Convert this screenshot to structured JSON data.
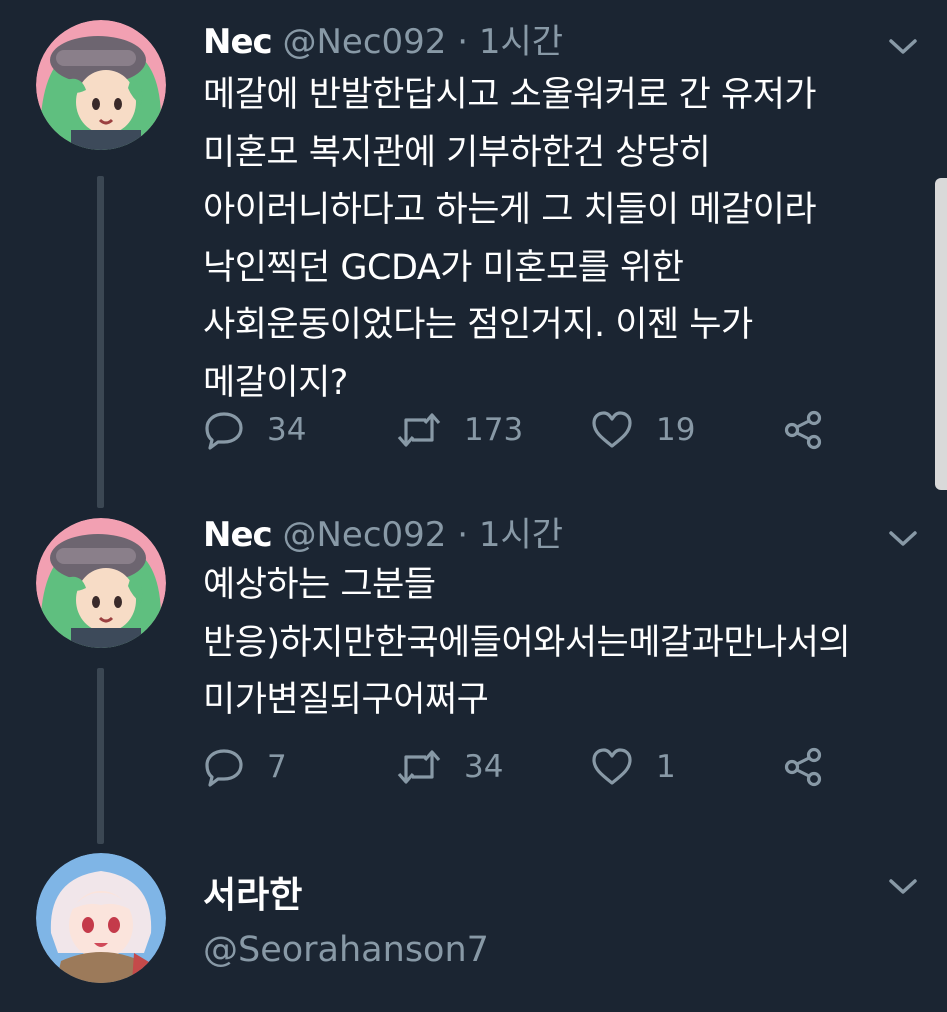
{
  "colors": {
    "background": "#1b2532",
    "text_primary": "#ffffff",
    "text_secondary": "#8899a6",
    "thread_line": "#3b4753"
  },
  "tweets": [
    {
      "name": "Nec",
      "handle": "@Nec092",
      "separator": "·",
      "time": "1시간",
      "avatar": "green-hair-character-avatar",
      "lines": [
        "메갈에 반발한답시고 소울워커로 간 유저가",
        "미혼모 복지관에 기부하한건 상당히",
        "아이러니하다고 하는게 그 치들이 메갈이라",
        "낙인찍던 GCDA가 미혼모를 위한",
        "사회운동이었다는 점인거지. 이젠 누가",
        "메갈이지?"
      ],
      "replies": "34",
      "retweets": "173",
      "likes": "19"
    },
    {
      "name": "Nec",
      "handle": "@Nec092",
      "separator": "·",
      "time": "1시간",
      "avatar": "green-hair-character-avatar",
      "lines": [
        "예상하는 그분들",
        "반응)하지만한국에들어와서는메갈과만나서의",
        "미가변질되구어쩌구"
      ],
      "replies": "7",
      "retweets": "34",
      "likes": "1"
    }
  ],
  "user_card": {
    "name": "서라한",
    "handle": "@Seorahanson7",
    "avatar": "white-hair-character-avatar"
  },
  "icons": {
    "reply": "reply-icon",
    "retweet": "retweet-icon",
    "like": "heart-icon",
    "share": "share-icon",
    "menu": "chevron-down-icon"
  }
}
